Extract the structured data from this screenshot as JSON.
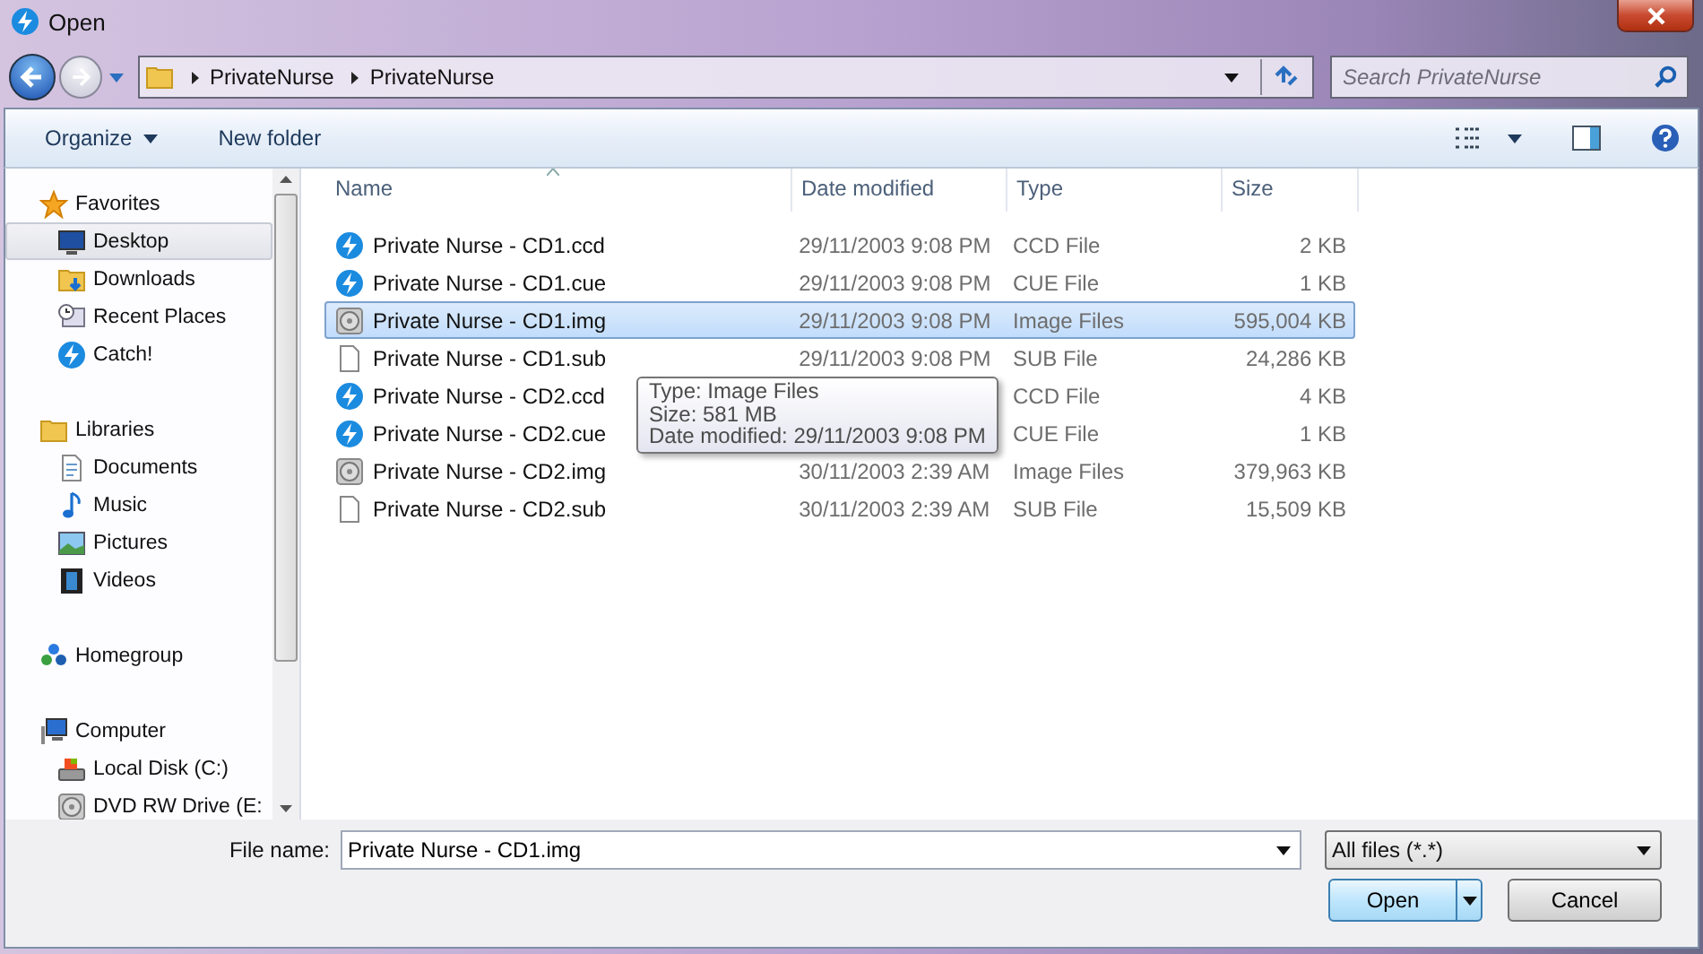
{
  "window": {
    "title": "Open"
  },
  "address_bar": {
    "path": [
      "PrivateNurse",
      "PrivateNurse"
    ]
  },
  "search": {
    "placeholder": "Search PrivateNurse"
  },
  "toolbar": {
    "organize": "Organize",
    "new_folder": "New folder"
  },
  "sidebar": {
    "groups": [
      {
        "label": "Favorites",
        "selected": false,
        "children": [
          {
            "label": "Desktop",
            "selected": true
          },
          {
            "label": "Downloads",
            "selected": false
          },
          {
            "label": "Recent Places",
            "selected": false
          },
          {
            "label": "Catch!",
            "selected": false
          }
        ]
      },
      {
        "label": "Libraries",
        "selected": false,
        "children": [
          {
            "label": "Documents",
            "selected": false
          },
          {
            "label": "Music",
            "selected": false
          },
          {
            "label": "Pictures",
            "selected": false
          },
          {
            "label": "Videos",
            "selected": false
          }
        ]
      },
      {
        "label": "Homegroup",
        "selected": false
      },
      {
        "label": "Computer",
        "selected": false,
        "children": [
          {
            "label": "Local Disk (C:)",
            "selected": false
          },
          {
            "label": "DVD RW Drive (E:",
            "selected": false
          }
        ]
      }
    ]
  },
  "table": {
    "columns": [
      "Name",
      "Date modified",
      "Type",
      "Size"
    ],
    "rows": [
      {
        "name": "Private Nurse - CD1.ccd",
        "date": "29/11/2003 9:08 PM",
        "type": "CCD File",
        "size": "2 KB",
        "kind": "app",
        "selected": false
      },
      {
        "name": "Private Nurse - CD1.cue",
        "date": "29/11/2003 9:08 PM",
        "type": "CUE File",
        "size": "1 KB",
        "kind": "app",
        "selected": false
      },
      {
        "name": "Private Nurse - CD1.img",
        "date": "29/11/2003 9:08 PM",
        "type": "Image Files",
        "size": "595,004 KB",
        "kind": "disc",
        "selected": true
      },
      {
        "name": "Private Nurse - CD1.sub",
        "date": "29/11/2003 9:08 PM",
        "type": "SUB File",
        "size": "24,286 KB",
        "kind": "blank",
        "selected": false
      },
      {
        "name": "Private Nurse - CD2.ccd",
        "type": "CCD File",
        "size": "4 KB",
        "kind": "app",
        "selected": false
      },
      {
        "name": "Private Nurse - CD2.cue",
        "type": "CUE File",
        "size": "1 KB",
        "kind": "app",
        "selected": false
      },
      {
        "name": "Private Nurse - CD2.img",
        "date": "30/11/2003 2:39 AM",
        "type": "Image Files",
        "size": "379,963 KB",
        "kind": "disc",
        "selected": false
      },
      {
        "name": "Private Nurse - CD2.sub",
        "date": "30/11/2003 2:39 AM",
        "type": "SUB File",
        "size": "15,509 KB",
        "kind": "blank",
        "selected": false
      }
    ]
  },
  "tooltip": {
    "lines": [
      "Type: Image Files",
      "Size: 581 MB",
      "Date modified: 29/11/2003 9:08 PM"
    ]
  },
  "footer": {
    "file_name_label": "File name:",
    "file_name": "Private Nurse - CD1.img",
    "filter": "All files (*.*)",
    "open": "Open",
    "cancel": "Cancel"
  }
}
